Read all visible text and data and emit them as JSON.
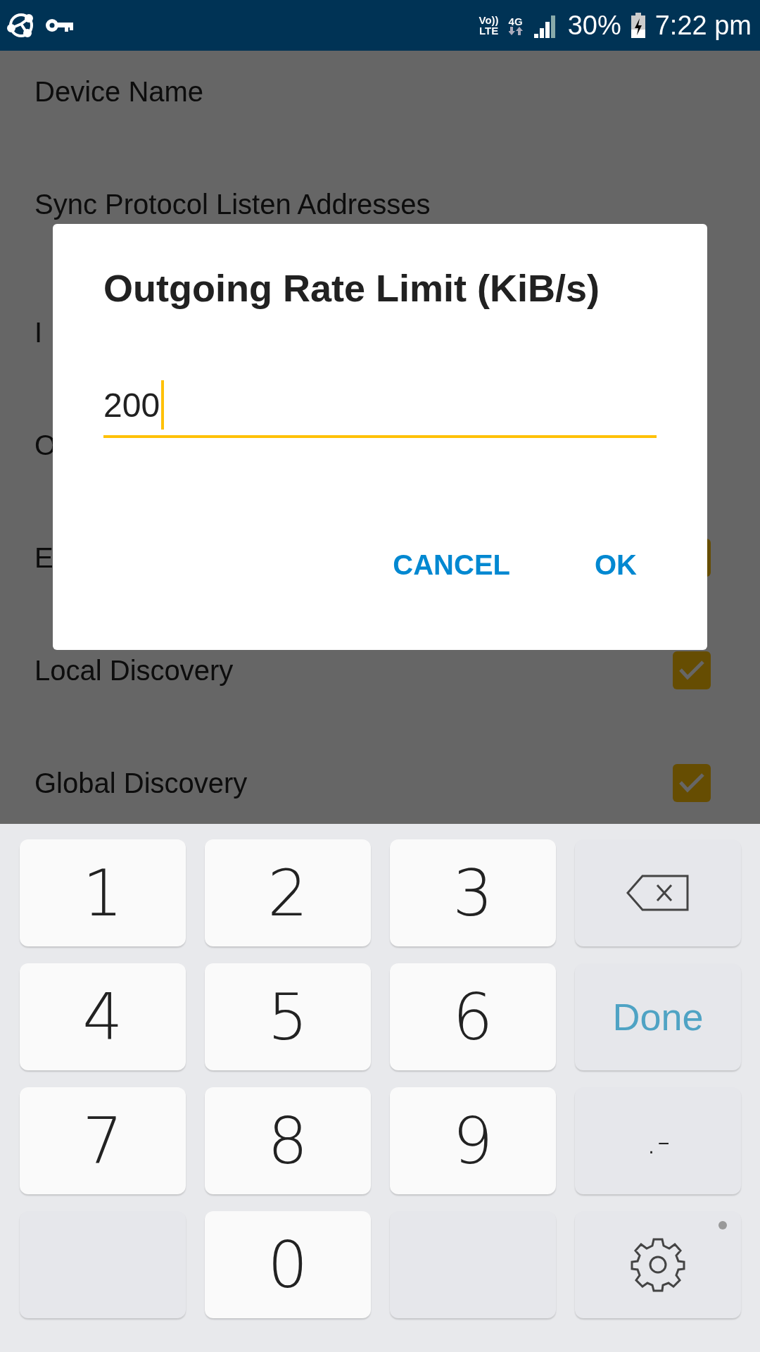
{
  "status_bar": {
    "volte_top": "Vo))",
    "volte_bottom": "LTE",
    "network": "4G",
    "battery": "30%",
    "time": "7:22 pm"
  },
  "settings": [
    {
      "label": "Device Name",
      "kind": "text"
    },
    {
      "label": "Sync Protocol Listen Addresses",
      "kind": "text"
    },
    {
      "label": "I",
      "kind": "text"
    },
    {
      "label": "O",
      "kind": "text"
    },
    {
      "label": "E",
      "kind": "covered_checkbox",
      "checked": true
    },
    {
      "label": "Local Discovery",
      "kind": "checkbox",
      "checked": true
    },
    {
      "label": "Global Discovery",
      "kind": "checkbox",
      "checked": true
    }
  ],
  "dialog": {
    "title": "Outgoing Rate Limit (KiB/s)",
    "value": "200",
    "buttons": [
      "CANCEL",
      "OK"
    ]
  },
  "keyboard": [
    {
      "kind": "digit",
      "label": "1"
    },
    {
      "kind": "digit",
      "label": "2"
    },
    {
      "kind": "digit",
      "label": "3"
    },
    {
      "kind": "backspace"
    },
    {
      "kind": "digit",
      "label": "4"
    },
    {
      "kind": "digit",
      "label": "5"
    },
    {
      "kind": "digit",
      "label": "6"
    },
    {
      "kind": "done",
      "label": "Done"
    },
    {
      "kind": "digit",
      "label": "7"
    },
    {
      "kind": "digit",
      "label": "8"
    },
    {
      "kind": "digit",
      "label": "9"
    },
    {
      "kind": "symbol",
      "label": ".-"
    },
    {
      "kind": "blank"
    },
    {
      "kind": "digit",
      "label": "0"
    },
    {
      "kind": "blank"
    },
    {
      "kind": "settings"
    }
  ]
}
